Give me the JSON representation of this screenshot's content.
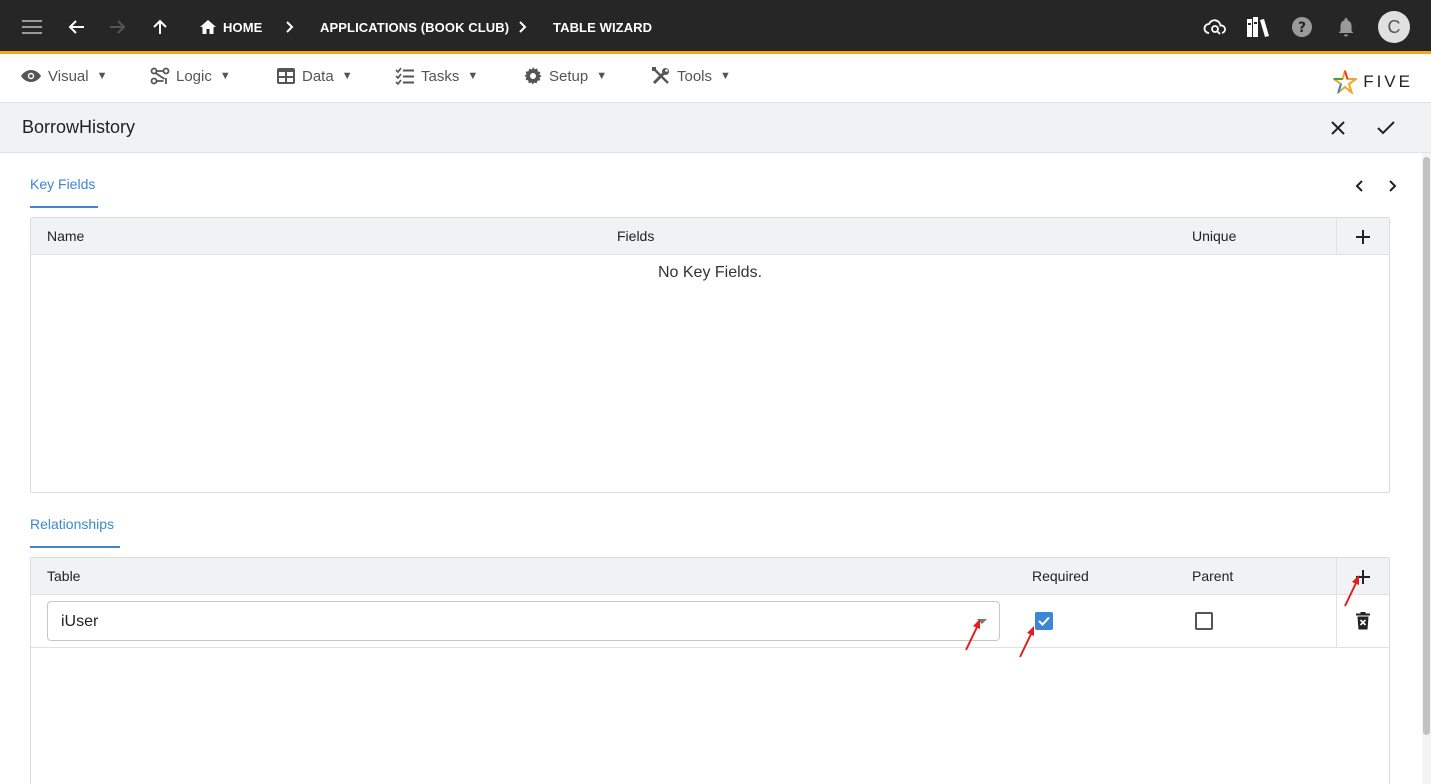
{
  "topbar": {
    "breadcrumbs": [
      "HOME",
      "APPLICATIONS (BOOK CLUB)",
      "TABLE WIZARD"
    ],
    "avatar_initial": "C"
  },
  "menus": [
    "Visual",
    "Logic",
    "Data",
    "Tasks",
    "Setup",
    "Tools"
  ],
  "logo": {
    "text": "FIVE"
  },
  "form": {
    "title": "BorrowHistory"
  },
  "key_fields": {
    "title": "Key Fields",
    "columns": [
      "Name",
      "Fields",
      "Unique"
    ],
    "empty_message": "No Key Fields."
  },
  "relationships": {
    "title": "Relationships",
    "columns": [
      "Table",
      "Required",
      "Parent"
    ],
    "rows": [
      {
        "table": "iUser",
        "required": true,
        "parent": false
      }
    ]
  },
  "colors": {
    "accent": "#3d86d4",
    "topbar": "#262626",
    "topbar_border": "#f5a623",
    "annotation_arrow": "#e02020"
  }
}
